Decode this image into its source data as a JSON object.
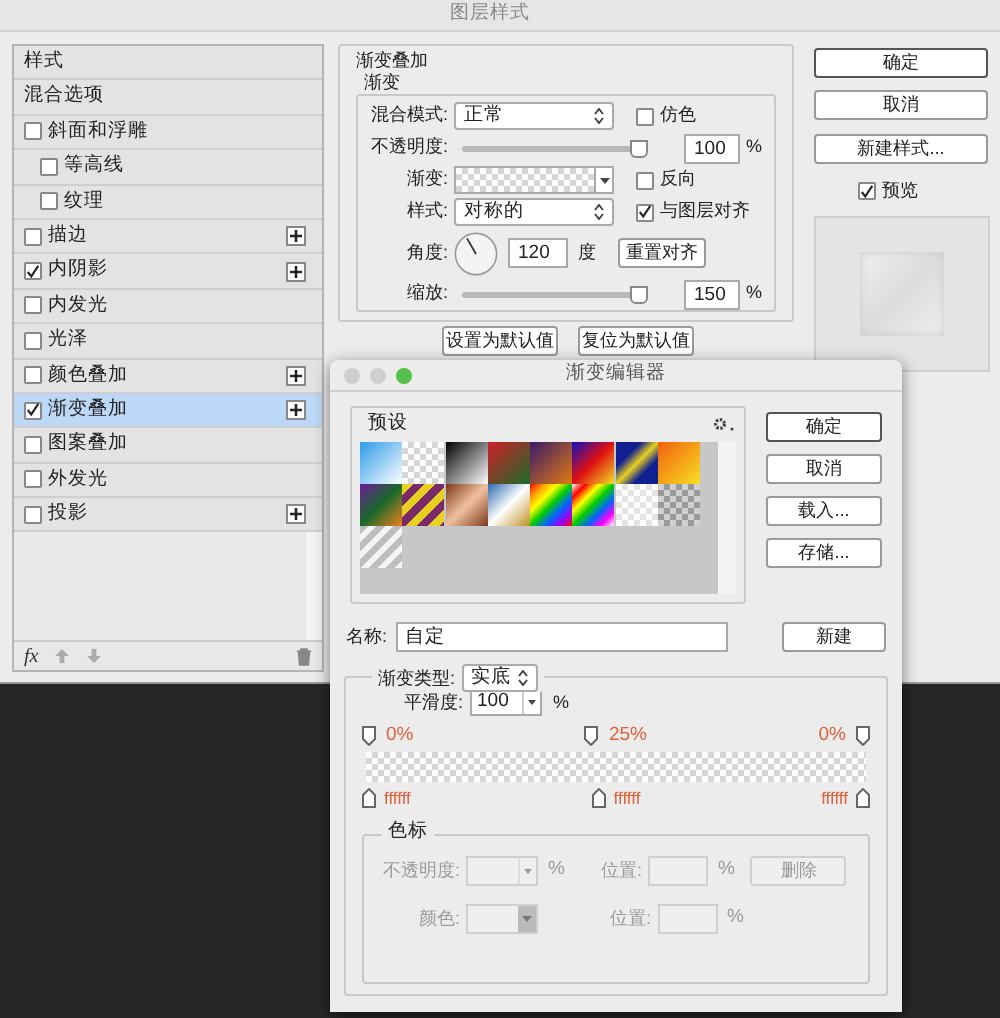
{
  "layer_style": {
    "title": "图层样式",
    "sidebar": {
      "items": [
        {
          "label": "样式",
          "kind": "header",
          "selected": false
        },
        {
          "label": "混合选项",
          "kind": "header",
          "selected": false
        },
        {
          "label": "斜面和浮雕",
          "kind": "effect",
          "checked": false,
          "add": false,
          "selected": false,
          "children": [
            {
              "label": "等高线",
              "kind": "effect",
              "checked": false,
              "add": false,
              "selected": false
            },
            {
              "label": "纹理",
              "kind": "effect",
              "checked": false,
              "add": false,
              "selected": false
            }
          ]
        },
        {
          "label": "描边",
          "kind": "effect",
          "checked": false,
          "add": true,
          "selected": false
        },
        {
          "label": "内阴影",
          "kind": "effect",
          "checked": true,
          "add": true,
          "selected": false
        },
        {
          "label": "内发光",
          "kind": "effect",
          "checked": false,
          "add": false,
          "selected": false
        },
        {
          "label": "光泽",
          "kind": "effect",
          "checked": false,
          "add": false,
          "selected": false
        },
        {
          "label": "颜色叠加",
          "kind": "effect",
          "checked": false,
          "add": true,
          "selected": false
        },
        {
          "label": "渐变叠加",
          "kind": "effect",
          "checked": true,
          "add": true,
          "selected": true
        },
        {
          "label": "图案叠加",
          "kind": "effect",
          "checked": false,
          "add": false,
          "selected": false
        },
        {
          "label": "外发光",
          "kind": "effect",
          "checked": false,
          "add": false,
          "selected": false
        },
        {
          "label": "投影",
          "kind": "effect",
          "checked": false,
          "add": true,
          "selected": false
        }
      ],
      "footer": {
        "fx": "fx"
      }
    },
    "panel": {
      "group_title": "渐变叠加",
      "subgroup_title": "渐变",
      "blend_mode": {
        "label": "混合模式:",
        "value": "正常"
      },
      "dither": {
        "label": "仿色",
        "checked": false
      },
      "opacity": {
        "label": "不透明度:",
        "value": "100",
        "unit": "%",
        "level": 0.97
      },
      "gradient": {
        "label": "渐变:"
      },
      "reverse": {
        "label": "反向",
        "checked": false
      },
      "style": {
        "label": "样式:",
        "value": "对称的"
      },
      "align": {
        "label": "与图层对齐",
        "checked": true
      },
      "angle": {
        "label": "角度:",
        "value": "120",
        "unit": "度"
      },
      "reset_align": "重置对齐",
      "scale": {
        "label": "缩放:",
        "value": "150",
        "unit": "%",
        "level": 0.97
      },
      "buttons": [
        "设置为默认值",
        "复位为默认值"
      ]
    },
    "actions": [
      "确定",
      "取消",
      "新建样式..."
    ],
    "preview": {
      "label": "预览",
      "checked": true
    }
  },
  "gradient_editor": {
    "title": "渐变编辑器",
    "presets": {
      "label": "预设"
    },
    "buttons": [
      "确定",
      "取消",
      "载入...",
      "存储..."
    ],
    "name": {
      "label": "名称:",
      "value": "自定"
    },
    "new_button": "新建",
    "type": {
      "label": "渐变类型:",
      "value": "实底"
    },
    "smoothness": {
      "label": "平滑度:",
      "value": "100",
      "unit": "%"
    },
    "opacity_stops": [
      {
        "label": "0%"
      },
      {
        "label": "25%"
      },
      {
        "label": "0%"
      }
    ],
    "color_stops": [
      {
        "label": "ffffff"
      },
      {
        "label": "ffffff"
      },
      {
        "label": "ffffff"
      }
    ],
    "stops": {
      "title": "色标",
      "disabled": true,
      "opacity_label": "不透明度:",
      "opacity_unit": "%",
      "position_label": "位置:",
      "position_unit": "%",
      "delete": "删除",
      "color_label": "颜色:",
      "position_label_2": "位置:",
      "position_unit_2": "%"
    }
  }
}
